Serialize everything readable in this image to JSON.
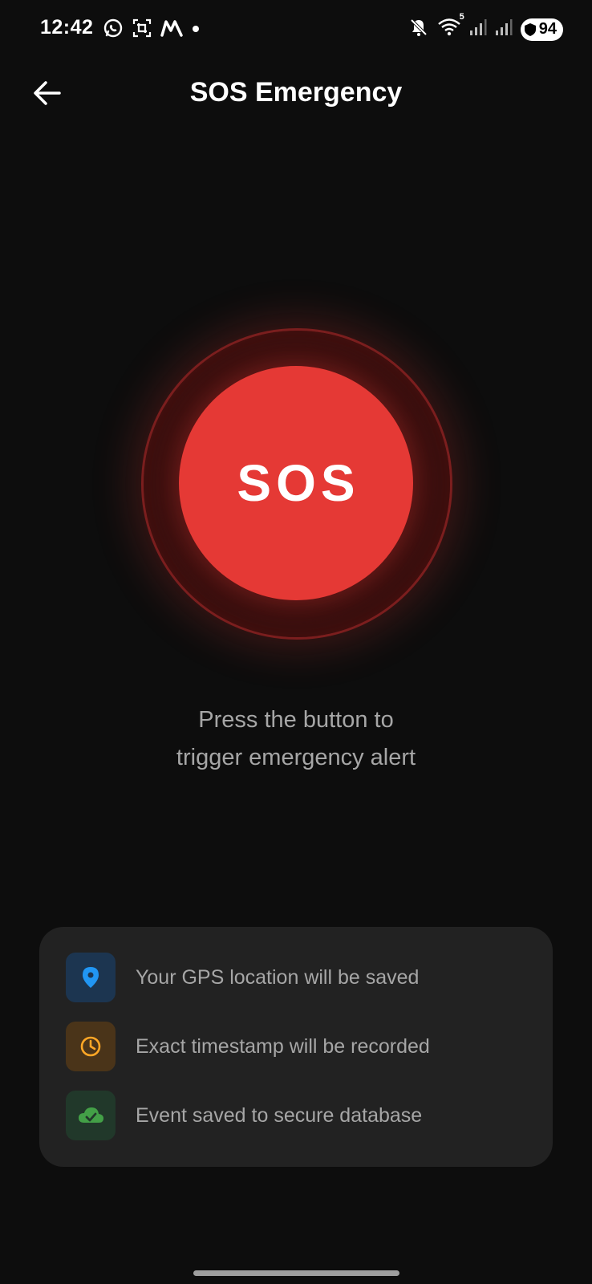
{
  "status_bar": {
    "time": "12:42",
    "left_icons": [
      "whatsapp-icon",
      "screenshot-icon",
      "app-m-icon",
      "notification-dot-icon"
    ],
    "right_icons": [
      "mute-icon",
      "wifi-icon",
      "signal-icon",
      "signal-icon"
    ],
    "wifi_badge": "5",
    "battery_level": "94"
  },
  "app_bar": {
    "title": "SOS Emergency",
    "back_icon": "arrow-left-icon"
  },
  "sos": {
    "label": "SOS",
    "color": "#e53935"
  },
  "instruction": {
    "line1": "Press the button to",
    "line2": "trigger emergency alert"
  },
  "info": {
    "items": [
      {
        "icon": "location-pin-icon",
        "text": "Your GPS location will be saved",
        "color": "#2196f3"
      },
      {
        "icon": "clock-icon",
        "text": "Exact timestamp will be recorded",
        "color": "#ffa726"
      },
      {
        "icon": "cloud-check-icon",
        "text": "Event saved to secure database",
        "color": "#43a047"
      }
    ]
  }
}
